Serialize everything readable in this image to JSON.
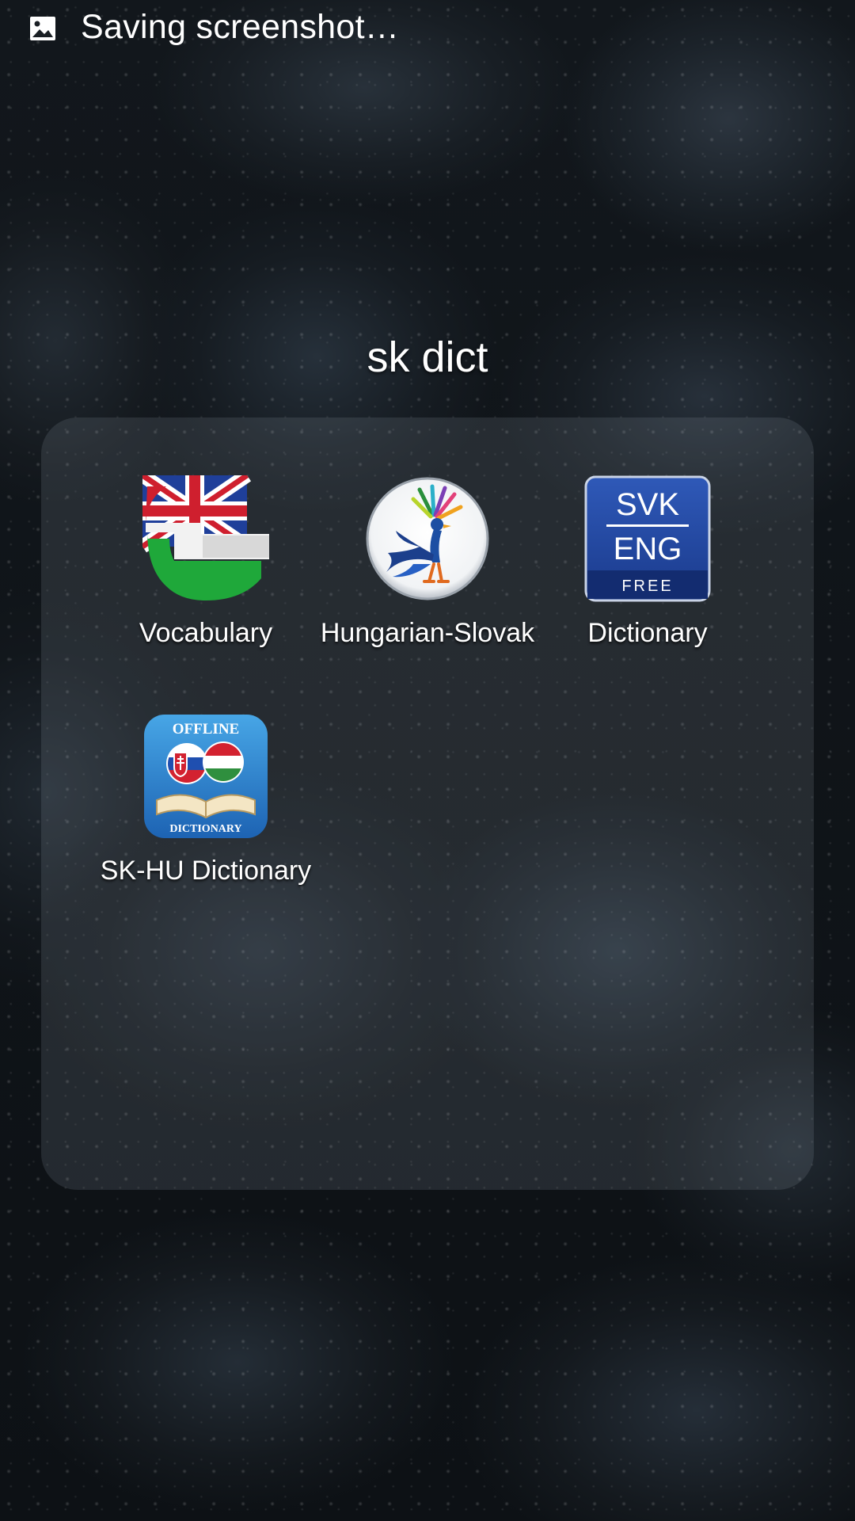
{
  "status_bar": {
    "icon": "image-icon",
    "text": "Saving screenshot…"
  },
  "folder": {
    "title": "sk dict",
    "apps": [
      {
        "label": "Vocabulary",
        "icon": "uk-hungary-g-icon"
      },
      {
        "label": "Hungarian-Slovak",
        "icon": "peacock-icon"
      },
      {
        "label": "Dictionary",
        "icon": "svk-eng-free-icon",
        "icon_text": {
          "line1": "SVK",
          "line2": "ENG",
          "line3": "FREE"
        }
      },
      {
        "label": "SK-HU Dictionary",
        "icon": "offline-dictionary-icon",
        "icon_text": {
          "top": "OFFLINE",
          "bottom": "DICTIONARY"
        }
      }
    ]
  }
}
